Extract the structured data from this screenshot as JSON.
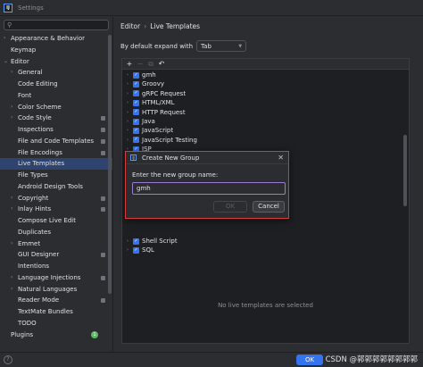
{
  "window": {
    "title": "Settings",
    "app_icon": "IJ"
  },
  "search": {
    "placeholder": "",
    "value": ""
  },
  "sidebar": {
    "items": [
      {
        "label": "Appearance & Behavior",
        "level": 0,
        "arrow": "›",
        "selected": false,
        "mark": false,
        "badge": ""
      },
      {
        "label": "Keymap",
        "level": 0,
        "arrow": "",
        "selected": false,
        "mark": false,
        "badge": ""
      },
      {
        "label": "Editor",
        "level": 0,
        "arrow": "⌄",
        "selected": false,
        "mark": false,
        "badge": ""
      },
      {
        "label": "General",
        "level": 1,
        "arrow": "›",
        "selected": false,
        "mark": false,
        "badge": ""
      },
      {
        "label": "Code Editing",
        "level": 1,
        "arrow": "",
        "selected": false,
        "mark": false,
        "badge": ""
      },
      {
        "label": "Font",
        "level": 1,
        "arrow": "",
        "selected": false,
        "mark": false,
        "badge": ""
      },
      {
        "label": "Color Scheme",
        "level": 1,
        "arrow": "›",
        "selected": false,
        "mark": false,
        "badge": ""
      },
      {
        "label": "Code Style",
        "level": 1,
        "arrow": "›",
        "selected": false,
        "mark": true,
        "badge": ""
      },
      {
        "label": "Inspections",
        "level": 1,
        "arrow": "",
        "selected": false,
        "mark": true,
        "badge": ""
      },
      {
        "label": "File and Code Templates",
        "level": 1,
        "arrow": "",
        "selected": false,
        "mark": true,
        "badge": ""
      },
      {
        "label": "File Encodings",
        "level": 1,
        "arrow": "",
        "selected": false,
        "mark": true,
        "badge": ""
      },
      {
        "label": "Live Templates",
        "level": 1,
        "arrow": "",
        "selected": true,
        "mark": false,
        "badge": ""
      },
      {
        "label": "File Types",
        "level": 1,
        "arrow": "",
        "selected": false,
        "mark": false,
        "badge": ""
      },
      {
        "label": "Android Design Tools",
        "level": 1,
        "arrow": "",
        "selected": false,
        "mark": false,
        "badge": ""
      },
      {
        "label": "Copyright",
        "level": 1,
        "arrow": "›",
        "selected": false,
        "mark": true,
        "badge": ""
      },
      {
        "label": "Inlay Hints",
        "level": 1,
        "arrow": "›",
        "selected": false,
        "mark": true,
        "badge": ""
      },
      {
        "label": "Compose Live Edit",
        "level": 1,
        "arrow": "",
        "selected": false,
        "mark": false,
        "badge": ""
      },
      {
        "label": "Duplicates",
        "level": 1,
        "arrow": "",
        "selected": false,
        "mark": false,
        "badge": ""
      },
      {
        "label": "Emmet",
        "level": 1,
        "arrow": "›",
        "selected": false,
        "mark": false,
        "badge": ""
      },
      {
        "label": "GUI Designer",
        "level": 1,
        "arrow": "",
        "selected": false,
        "mark": true,
        "badge": ""
      },
      {
        "label": "Intentions",
        "level": 1,
        "arrow": "",
        "selected": false,
        "mark": false,
        "badge": ""
      },
      {
        "label": "Language Injections",
        "level": 1,
        "arrow": "›",
        "selected": false,
        "mark": true,
        "badge": ""
      },
      {
        "label": "Natural Languages",
        "level": 1,
        "arrow": "›",
        "selected": false,
        "mark": false,
        "badge": ""
      },
      {
        "label": "Reader Mode",
        "level": 1,
        "arrow": "",
        "selected": false,
        "mark": true,
        "badge": ""
      },
      {
        "label": "TextMate Bundles",
        "level": 1,
        "arrow": "",
        "selected": false,
        "mark": false,
        "badge": ""
      },
      {
        "label": "TODO",
        "level": 1,
        "arrow": "",
        "selected": false,
        "mark": false,
        "badge": ""
      },
      {
        "label": "Plugins",
        "level": 0,
        "arrow": "",
        "selected": false,
        "mark": false,
        "badge": "1"
      }
    ]
  },
  "main": {
    "breadcrumb": {
      "parent": "Editor",
      "separator": "›",
      "current": "Live Templates"
    },
    "expand": {
      "label": "By default expand with",
      "value": "Tab"
    },
    "toolbar": {
      "add": "+",
      "remove": "−",
      "copy": "⧉",
      "undo": "↶"
    },
    "groups_top": [
      "gmh",
      "Groovy",
      "gRPC Request",
      "HTML/XML",
      "HTTP Request",
      "Java",
      "JavaScript",
      "JavaScript Testing",
      "JSP"
    ],
    "groups_bottom": [
      "Shell Script",
      "SQL"
    ],
    "empty_text": "No live templates are selected"
  },
  "dialog": {
    "title": "Create New Group",
    "label": "Enter the new group name:",
    "input_value": "gmh",
    "ok_label": "OK",
    "cancel_label": "Cancel"
  },
  "footer": {
    "help": "?",
    "ok_label": "OK",
    "watermark": "CSDN @郭郭郭郭郭郭郭郭"
  },
  "colors": {
    "accent": "#3574f0",
    "selection": "#2e436e",
    "highlight_border": "#d43b3b",
    "focus_border": "#9a7bd2"
  }
}
